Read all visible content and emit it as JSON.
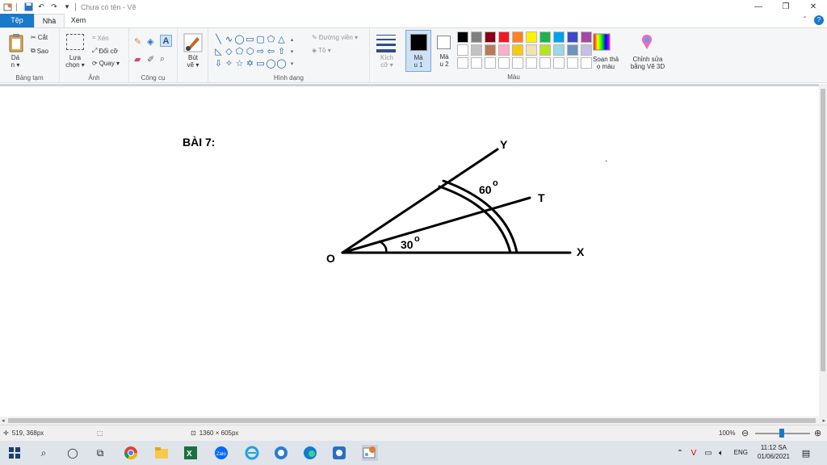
{
  "window": {
    "title": "Chưa có tên - Vẽ"
  },
  "tabs": [
    {
      "label": "Tệp"
    },
    {
      "label": "Nhà"
    },
    {
      "label": "Xem"
    }
  ],
  "ribbon": {
    "clipboard": {
      "paste": "Dá\nn ▾",
      "cut": "Cắt",
      "copy": "Sao",
      "label": "Bảng tạm"
    },
    "image": {
      "select": "Lựa\nchọn ▾",
      "crop": "Xén",
      "resize": "Đổi cỡ",
      "rotate": "Quay ▾",
      "label": "Ảnh"
    },
    "tools": {
      "label": "Công cụ"
    },
    "brushes": {
      "label": "Bút\nvẽ ▾"
    },
    "shapes": {
      "outline": "Đường viền ▾",
      "fill": "Tô ▾",
      "label": "Hình dạng"
    },
    "size": {
      "label": "Kích\ncỡ ▾"
    },
    "color1": {
      "label": "Mà\nu 1"
    },
    "color2": {
      "label": "Mà\nu 2"
    },
    "colors": {
      "label": "Màu",
      "edit": "Soạn thả\no màu",
      "paint3d": "Chỉnh sửa\nbằng Vẽ 3D"
    },
    "palette": [
      "#000000",
      "#7f7f7f",
      "#880015",
      "#ed1c24",
      "#ff7f27",
      "#fff200",
      "#22b14c",
      "#00a2e8",
      "#3f48cc",
      "#a349a4",
      "#ffffff",
      "#c3c3c3",
      "#b97a57",
      "#ffaec9",
      "#ffc90e",
      "#efe4b0",
      "#b5e61d",
      "#99d9ea",
      "#7092be",
      "#c8bfe7",
      "#ffffff",
      "#ffffff",
      "#ffffff",
      "#ffffff",
      "#ffffff",
      "#ffffff",
      "#ffffff",
      "#ffffff",
      "#ffffff",
      "#ffffff"
    ]
  },
  "canvas": {
    "heading": "BÀI 7:",
    "labels": {
      "o": "O",
      "x": "X",
      "y": "Y",
      "t": "T",
      "angle_small": "30",
      "angle_large": "60",
      "degree": "o"
    }
  },
  "statusbar": {
    "cursor": "519, 368px",
    "size": "1360 × 605px",
    "zoom": "100%"
  },
  "taskbar": {
    "language": "ENG",
    "time": "11:12 SA",
    "date": "01/06/2021"
  },
  "colors": {
    "accent": "#1979ca",
    "workspace": "#c9d3e1"
  }
}
